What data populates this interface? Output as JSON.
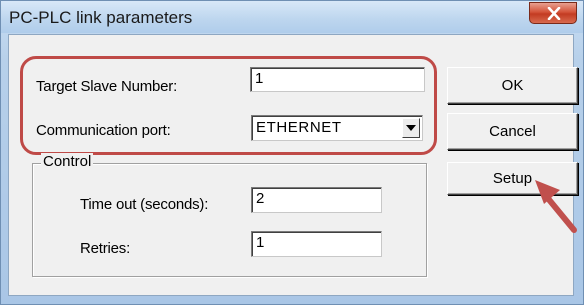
{
  "window": {
    "title": "PC-PLC link parameters",
    "close_label": "x"
  },
  "form": {
    "target_slave_label": "Target Slave Number:",
    "target_slave_value": "1",
    "comm_port_label": "Communication port:",
    "comm_port_value": "ETHERNET"
  },
  "control_group": {
    "label": "Control",
    "timeout_label": "Time out (seconds):",
    "timeout_value": "2",
    "retries_label": "Retries:",
    "retries_value": "1"
  },
  "buttons": {
    "ok": "OK",
    "cancel": "Cancel",
    "setup": "Setup"
  },
  "annotation": {
    "highlight_color": "#bf4a47",
    "arrow_color": "#c0504d"
  },
  "icons": [
    "close-icon",
    "dropdown-arrow-icon",
    "pointer-arrow-icon"
  ]
}
